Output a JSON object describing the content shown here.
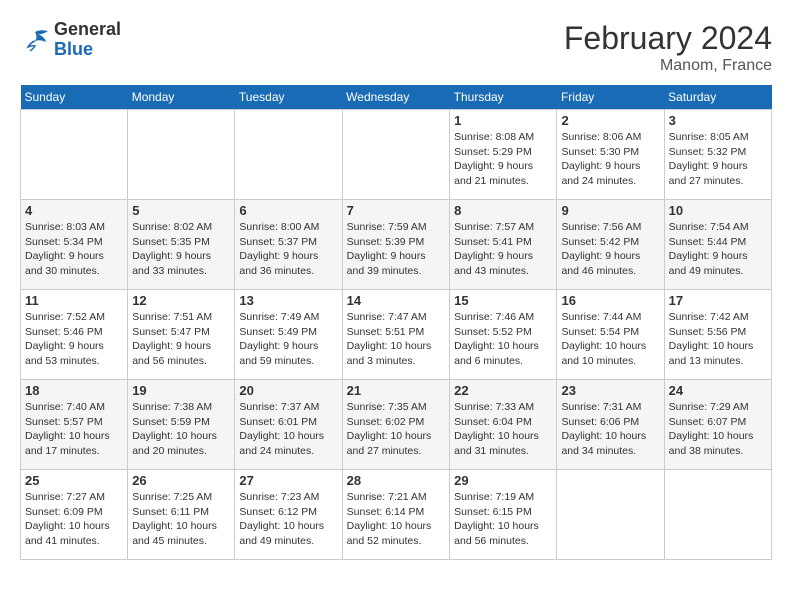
{
  "header": {
    "logo_line1": "General",
    "logo_line2": "Blue",
    "month_year": "February 2024",
    "location": "Manom, France"
  },
  "weekdays": [
    "Sunday",
    "Monday",
    "Tuesday",
    "Wednesday",
    "Thursday",
    "Friday",
    "Saturday"
  ],
  "weeks": [
    [
      {
        "day": "",
        "empty": true
      },
      {
        "day": "",
        "empty": true
      },
      {
        "day": "",
        "empty": true
      },
      {
        "day": "",
        "empty": true
      },
      {
        "day": "1",
        "sunrise": "8:08 AM",
        "sunset": "5:29 PM",
        "daylight": "9 hours and 21 minutes."
      },
      {
        "day": "2",
        "sunrise": "8:06 AM",
        "sunset": "5:30 PM",
        "daylight": "9 hours and 24 minutes."
      },
      {
        "day": "3",
        "sunrise": "8:05 AM",
        "sunset": "5:32 PM",
        "daylight": "9 hours and 27 minutes."
      }
    ],
    [
      {
        "day": "4",
        "sunrise": "8:03 AM",
        "sunset": "5:34 PM",
        "daylight": "9 hours and 30 minutes."
      },
      {
        "day": "5",
        "sunrise": "8:02 AM",
        "sunset": "5:35 PM",
        "daylight": "9 hours and 33 minutes."
      },
      {
        "day": "6",
        "sunrise": "8:00 AM",
        "sunset": "5:37 PM",
        "daylight": "9 hours and 36 minutes."
      },
      {
        "day": "7",
        "sunrise": "7:59 AM",
        "sunset": "5:39 PM",
        "daylight": "9 hours and 39 minutes."
      },
      {
        "day": "8",
        "sunrise": "7:57 AM",
        "sunset": "5:41 PM",
        "daylight": "9 hours and 43 minutes."
      },
      {
        "day": "9",
        "sunrise": "7:56 AM",
        "sunset": "5:42 PM",
        "daylight": "9 hours and 46 minutes."
      },
      {
        "day": "10",
        "sunrise": "7:54 AM",
        "sunset": "5:44 PM",
        "daylight": "9 hours and 49 minutes."
      }
    ],
    [
      {
        "day": "11",
        "sunrise": "7:52 AM",
        "sunset": "5:46 PM",
        "daylight": "9 hours and 53 minutes."
      },
      {
        "day": "12",
        "sunrise": "7:51 AM",
        "sunset": "5:47 PM",
        "daylight": "9 hours and 56 minutes."
      },
      {
        "day": "13",
        "sunrise": "7:49 AM",
        "sunset": "5:49 PM",
        "daylight": "9 hours and 59 minutes."
      },
      {
        "day": "14",
        "sunrise": "7:47 AM",
        "sunset": "5:51 PM",
        "daylight": "10 hours and 3 minutes."
      },
      {
        "day": "15",
        "sunrise": "7:46 AM",
        "sunset": "5:52 PM",
        "daylight": "10 hours and 6 minutes."
      },
      {
        "day": "16",
        "sunrise": "7:44 AM",
        "sunset": "5:54 PM",
        "daylight": "10 hours and 10 minutes."
      },
      {
        "day": "17",
        "sunrise": "7:42 AM",
        "sunset": "5:56 PM",
        "daylight": "10 hours and 13 minutes."
      }
    ],
    [
      {
        "day": "18",
        "sunrise": "7:40 AM",
        "sunset": "5:57 PM",
        "daylight": "10 hours and 17 minutes."
      },
      {
        "day": "19",
        "sunrise": "7:38 AM",
        "sunset": "5:59 PM",
        "daylight": "10 hours and 20 minutes."
      },
      {
        "day": "20",
        "sunrise": "7:37 AM",
        "sunset": "6:01 PM",
        "daylight": "10 hours and 24 minutes."
      },
      {
        "day": "21",
        "sunrise": "7:35 AM",
        "sunset": "6:02 PM",
        "daylight": "10 hours and 27 minutes."
      },
      {
        "day": "22",
        "sunrise": "7:33 AM",
        "sunset": "6:04 PM",
        "daylight": "10 hours and 31 minutes."
      },
      {
        "day": "23",
        "sunrise": "7:31 AM",
        "sunset": "6:06 PM",
        "daylight": "10 hours and 34 minutes."
      },
      {
        "day": "24",
        "sunrise": "7:29 AM",
        "sunset": "6:07 PM",
        "daylight": "10 hours and 38 minutes."
      }
    ],
    [
      {
        "day": "25",
        "sunrise": "7:27 AM",
        "sunset": "6:09 PM",
        "daylight": "10 hours and 41 minutes."
      },
      {
        "day": "26",
        "sunrise": "7:25 AM",
        "sunset": "6:11 PM",
        "daylight": "10 hours and 45 minutes."
      },
      {
        "day": "27",
        "sunrise": "7:23 AM",
        "sunset": "6:12 PM",
        "daylight": "10 hours and 49 minutes."
      },
      {
        "day": "28",
        "sunrise": "7:21 AM",
        "sunset": "6:14 PM",
        "daylight": "10 hours and 52 minutes."
      },
      {
        "day": "29",
        "sunrise": "7:19 AM",
        "sunset": "6:15 PM",
        "daylight": "10 hours and 56 minutes."
      },
      {
        "day": "",
        "empty": true
      },
      {
        "day": "",
        "empty": true
      }
    ]
  ]
}
